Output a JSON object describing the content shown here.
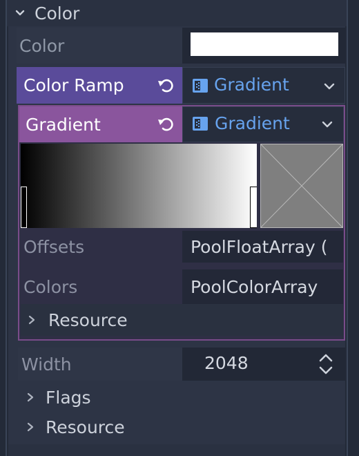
{
  "section": {
    "title": "Color"
  },
  "color": {
    "label": "Color",
    "value": "#ffffff"
  },
  "color_ramp": {
    "label": "Color Ramp",
    "resource_type": "Gradient"
  },
  "gradient": {
    "label": "Gradient",
    "resource_type": "Gradient",
    "stops": [
      {
        "offset": 0,
        "color": "#000000"
      },
      {
        "offset": 1,
        "color": "#ffffff"
      }
    ],
    "offsets": {
      "label": "Offsets",
      "value": "PoolFloatArray ("
    },
    "colors": {
      "label": "Colors",
      "value": "PoolColorArray"
    },
    "resource": {
      "label": "Resource"
    }
  },
  "width": {
    "label": "Width",
    "value": "2048"
  },
  "flags": {
    "label": "Flags"
  },
  "resource": {
    "label": "Resource"
  },
  "theme": {
    "accent": "#67a3ee",
    "ramp_key": "#5a4b9a",
    "gradient_key": "#8a559d"
  },
  "icons": [
    "chevron-down-icon",
    "revert-icon",
    "gradient-resource-icon",
    "dropdown-chevron-icon",
    "chevron-right-icon",
    "spinbox-arrows-icon"
  ]
}
